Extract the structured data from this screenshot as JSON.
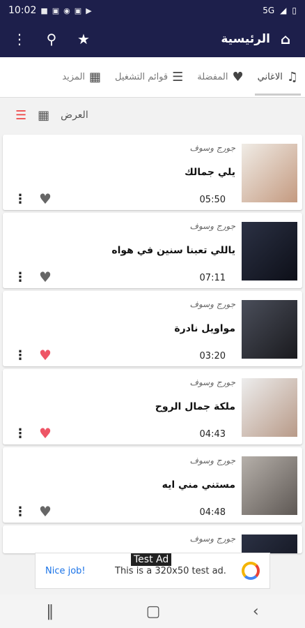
{
  "status": {
    "time": "10:02",
    "signal": "5G"
  },
  "appbar": {
    "title": "الرئيسية",
    "home_icon": "home-icon",
    "star_icon": "star-icon",
    "search_icon": "search-icon"
  },
  "tabs": [
    {
      "label": "الاغاني",
      "icon": "headphones-icon",
      "active": true
    },
    {
      "label": "المفضلة",
      "icon": "heart-icon"
    },
    {
      "label": "قوائم التشغيل",
      "icon": "playlist-icon"
    },
    {
      "label": "المزيد",
      "icon": "grid-icon"
    }
  ],
  "view": {
    "label": "العرض"
  },
  "songs": [
    {
      "artist": "جورج وسوف",
      "title": "يلي جمالك",
      "duration": "05:50",
      "favorite": false
    },
    {
      "artist": "جورج وسوف",
      "title": "ياللي تعبنا سنين في هواه",
      "duration": "07:11",
      "favorite": false
    },
    {
      "artist": "جورج وسوف",
      "title": "مواويل نادرة",
      "duration": "03:20",
      "favorite": true
    },
    {
      "artist": "جورج وسوف",
      "title": "ملكة جمال الروح",
      "duration": "04:43",
      "favorite": true
    },
    {
      "artist": "جورج وسوف",
      "title": "مستني مني ايه",
      "duration": "04:48",
      "favorite": false
    },
    {
      "artist": "جورج وسوف"
    }
  ],
  "ad": {
    "tag": "Test Ad",
    "headline": "Nice job!",
    "text": "This is a 320x50 test ad."
  },
  "colors": {
    "primary": "#1d1f4b",
    "favorite": "#ee5566"
  }
}
